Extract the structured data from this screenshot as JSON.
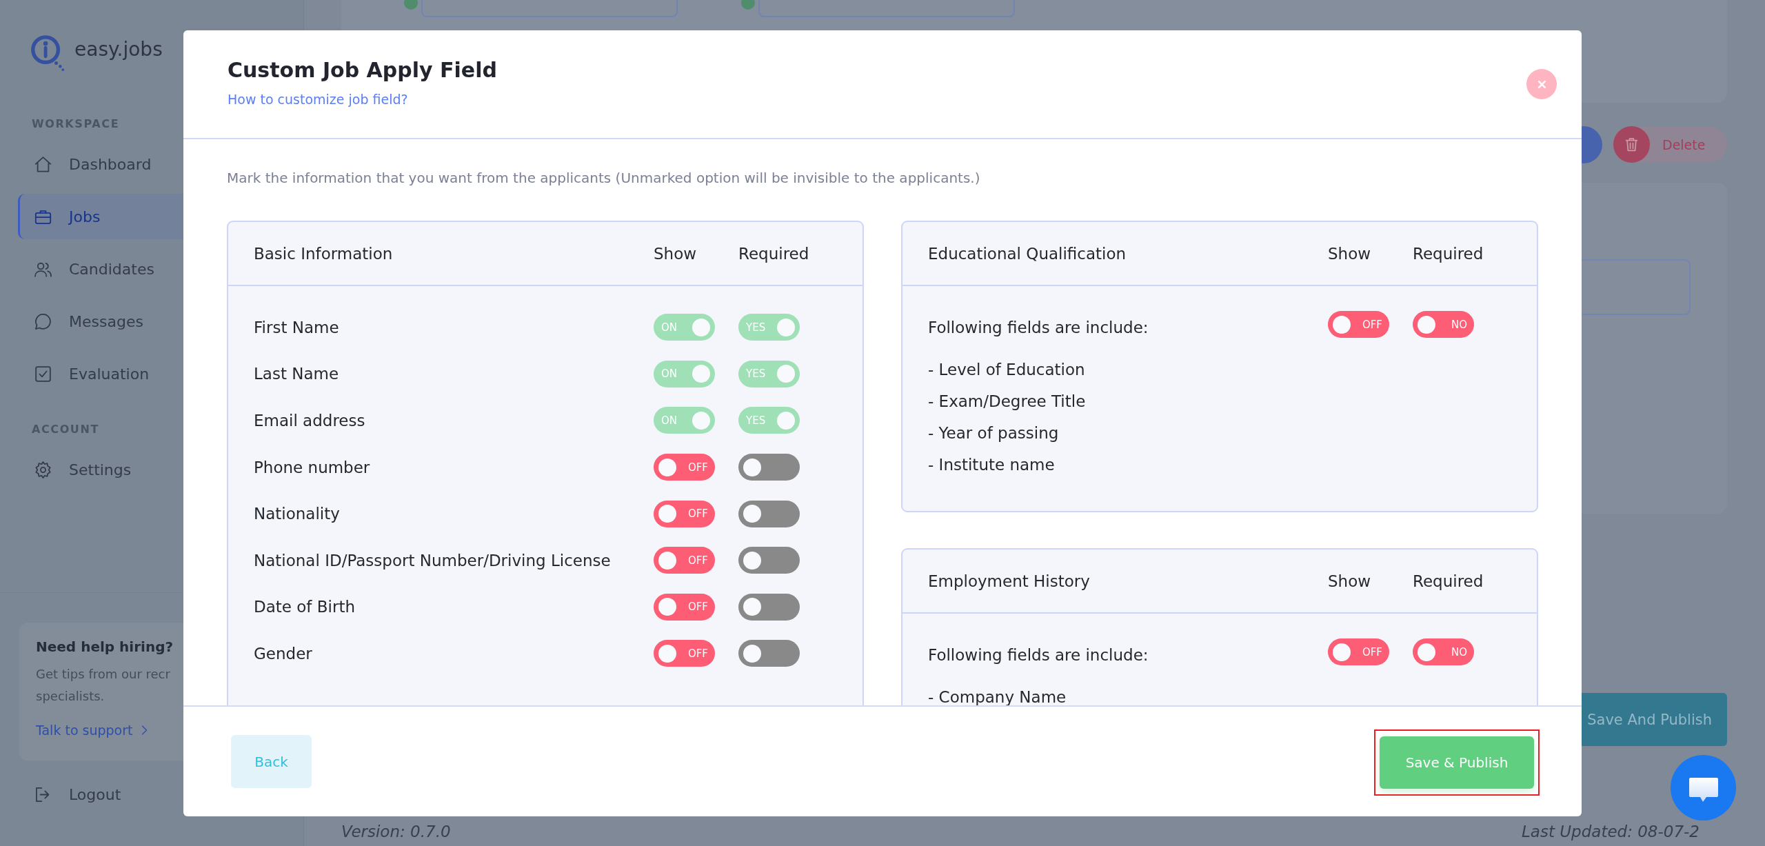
{
  "sidebar": {
    "logo": "easy.jobs",
    "sections": [
      {
        "heading": "WORKSPACE",
        "items": [
          {
            "label": "Dashboard",
            "selected": false
          },
          {
            "label": "Jobs",
            "selected": true
          },
          {
            "label": "Candidates",
            "selected": false
          },
          {
            "label": "Messages",
            "selected": false
          },
          {
            "label": "Evaluation",
            "selected": false
          }
        ]
      },
      {
        "heading": "ACCOUNT",
        "items": [
          {
            "label": "Settings",
            "selected": false
          }
        ]
      }
    ],
    "help_card": {
      "title": "Need help hiring?",
      "lines": [
        "Get tips from our recr",
        "specialists."
      ],
      "link": "Talk to support"
    },
    "logout": "Logout"
  },
  "page": {
    "delete_button": "Delete",
    "publish_button": "Save And Publish",
    "version": "Version: 0.7.0",
    "last_updated": "Last Updated: 08-07-2"
  },
  "modal": {
    "title": "Custom Job Apply Field",
    "help_link": "How to customize job field?",
    "intro": "Mark the information that you want from the applicants (Unmarked option will be invisible to the applicants.)",
    "columns": [
      {
        "panels": [
          {
            "kind": "rows",
            "title": "Basic Information",
            "show_heading": "Show",
            "required_heading": "Required",
            "rows": [
              {
                "label": "First Name",
                "show": {
                  "on": true,
                  "label": "ON"
                },
                "required": {
                  "on": true,
                  "disabled": false,
                  "label": "YES"
                }
              },
              {
                "label": "Last Name",
                "show": {
                  "on": true,
                  "label": "ON"
                },
                "required": {
                  "on": true,
                  "disabled": false,
                  "label": "YES"
                }
              },
              {
                "label": "Email address",
                "show": {
                  "on": true,
                  "label": "ON"
                },
                "required": {
                  "on": true,
                  "disabled": false,
                  "label": "YES"
                }
              },
              {
                "label": "Phone number",
                "show": {
                  "on": false,
                  "label": "OFF"
                },
                "required": {
                  "on": false,
                  "disabled": true
                }
              },
              {
                "label": "Nationality",
                "show": {
                  "on": false,
                  "label": "OFF"
                },
                "required": {
                  "on": false,
                  "disabled": true
                }
              },
              {
                "label": "National ID/Passport Number/Driving License",
                "show": {
                  "on": false,
                  "label": "OFF"
                },
                "required": {
                  "on": false,
                  "disabled": true
                }
              },
              {
                "label": "Date of Birth",
                "show": {
                  "on": false,
                  "label": "OFF"
                },
                "required": {
                  "on": false,
                  "disabled": true
                }
              },
              {
                "label": "Gender",
                "show": {
                  "on": false,
                  "label": "OFF"
                },
                "required": {
                  "on": false,
                  "disabled": true
                }
              }
            ]
          }
        ]
      },
      {
        "panels": [
          {
            "kind": "group",
            "title": "Educational Qualification",
            "show_heading": "Show",
            "required_heading": "Required",
            "intro": "Following fields are include:",
            "show": {
              "on": false,
              "label": "OFF"
            },
            "required": {
              "on": false,
              "disabled": false,
              "label": "NO"
            },
            "fields": [
              "- Level of Education",
              "- Exam/Degree Title",
              "- Year of passing",
              "- Institute name"
            ]
          },
          {
            "kind": "group",
            "title": "Employment History",
            "show_heading": "Show",
            "required_heading": "Required",
            "intro": "Following fields are include:",
            "show": {
              "on": false,
              "label": "OFF"
            },
            "required": {
              "on": false,
              "disabled": false,
              "label": "NO"
            },
            "fields": [
              "- Company Name"
            ]
          }
        ]
      }
    ],
    "footer": {
      "back_button": "Back",
      "save_button": {
        "label": "Save & Publish",
        "highlighted": true
      }
    }
  }
}
